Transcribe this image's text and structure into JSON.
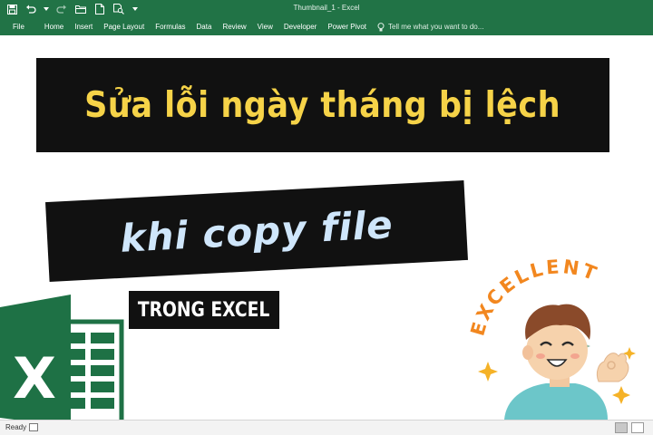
{
  "window": {
    "title": "Thumbnail_1 - Excel"
  },
  "quick_access": {
    "icons": [
      "save-icon",
      "undo-icon",
      "undo-dropdown-icon",
      "redo-icon",
      "open-folder-icon",
      "new-document-icon",
      "print-preview-icon",
      "customize-dropdown-icon"
    ]
  },
  "ribbon": {
    "tabs": [
      "File",
      "Home",
      "Insert",
      "Page Layout",
      "Formulas",
      "Data",
      "Review",
      "View",
      "Developer",
      "Power Pivot"
    ],
    "tell_me": "Tell me what you want to do..."
  },
  "thumbnail": {
    "headline": "Sửa lỗi ngày tháng bị lệch",
    "subheadline": "khi copy file",
    "tagline": "TRONG EXCEL",
    "badge_text": "EXCELLENT",
    "logo_letter": "X"
  },
  "statusbar": {
    "status": "Ready"
  },
  "colors": {
    "excel_green": "#217346",
    "headline_yellow": "#f6d348",
    "subheadline_blue": "#cfe6fb",
    "badge_orange": "#f2871f"
  }
}
